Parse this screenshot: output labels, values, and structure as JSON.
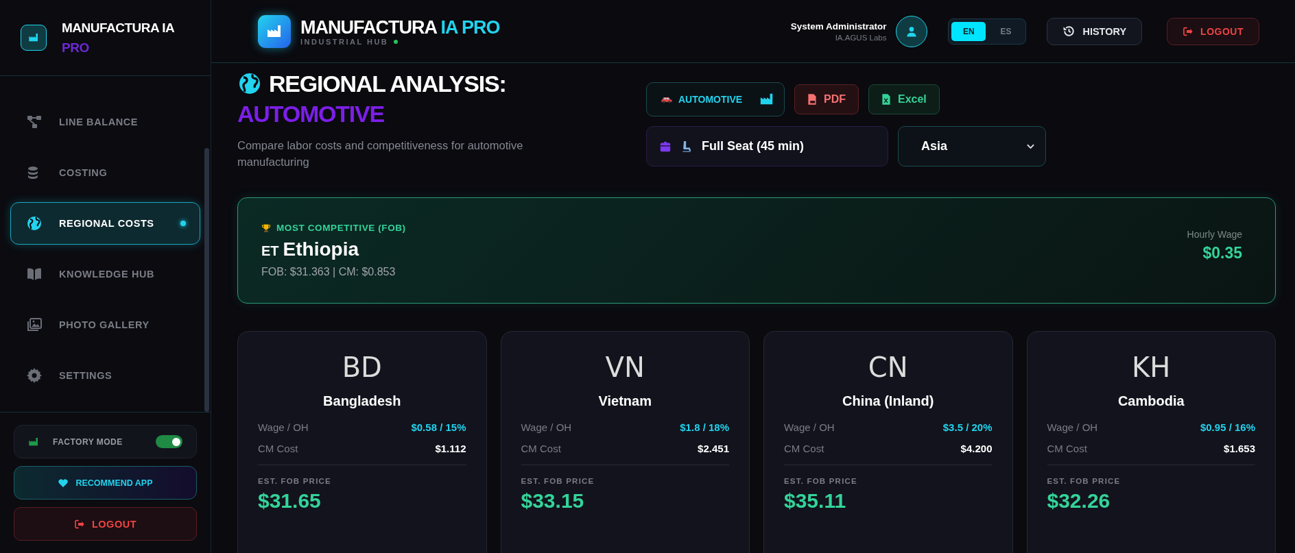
{
  "sidebar": {
    "brand": {
      "name": "MANUFACTURA IA",
      "tag": "PRO"
    },
    "items": [
      {
        "label": "LINE BALANCE",
        "selected": false
      },
      {
        "label": "COSTING",
        "selected": false
      },
      {
        "label": "REGIONAL COSTS",
        "selected": true
      },
      {
        "label": "KNOWLEDGE HUB",
        "selected": false
      },
      {
        "label": "PHOTO GALLERY",
        "selected": false
      },
      {
        "label": "SETTINGS",
        "selected": false
      }
    ],
    "factory_mode": {
      "label": "FACTORY MODE",
      "on": true
    },
    "recommend": "RECOMMEND APP",
    "logout": "LOGOUT"
  },
  "header": {
    "brand": {
      "name": "MANUFACTURA",
      "accent": "IA PRO",
      "subtitle": "INDUSTRIAL HUB"
    },
    "user": {
      "name": "System Administrator",
      "org": "IA.AGUS Labs"
    },
    "languages": [
      {
        "label": "EN",
        "selected": true
      },
      {
        "label": "ES",
        "selected": false
      }
    ],
    "history": "HISTORY",
    "logout": "LOGOUT"
  },
  "page": {
    "title": "REGIONAL ANALYSIS:",
    "title_accent": "AUTOMOTIVE",
    "description": "Compare labor costs and competitiveness for automotive manufacturing",
    "industry": "AUTOMOTIVE",
    "exports": [
      {
        "label": "PDF",
        "kind": "pdf"
      },
      {
        "label": "Excel",
        "kind": "excel"
      }
    ],
    "product": "Full Seat (45 min)",
    "region": "Asia"
  },
  "best": {
    "label": "MOST COMPETITIVE (FOB)",
    "code": "ET",
    "country": "Ethiopia",
    "detail": "FOB: $31.363 | CM: $0.853",
    "wage_label": "Hourly Wage",
    "wage": "$0.35"
  },
  "countries": [
    {
      "code": "BD",
      "name": "Bangladesh",
      "wage_label": "Wage / OH",
      "wage": "$0.58 / 15%",
      "cm_label": "CM Cost",
      "cm": "$1.112",
      "fob_label": "EST. FOB PRICE",
      "fob": "$31.65"
    },
    {
      "code": "VN",
      "name": "Vietnam",
      "wage_label": "Wage / OH",
      "wage": "$1.8 / 18%",
      "cm_label": "CM Cost",
      "cm": "$2.451",
      "fob_label": "EST. FOB PRICE",
      "fob": "$33.15"
    },
    {
      "code": "CN",
      "name": "China (Inland)",
      "wage_label": "Wage / OH",
      "wage": "$3.5 / 20%",
      "cm_label": "CM Cost",
      "cm": "$4.200",
      "fob_label": "EST. FOB PRICE",
      "fob": "$35.11"
    },
    {
      "code": "KH",
      "name": "Cambodia",
      "wage_label": "Wage / OH",
      "wage": "$0.95 / 16%",
      "cm_label": "CM Cost",
      "cm": "$1.653",
      "fob_label": "EST. FOB PRICE",
      "fob": "$32.26"
    }
  ]
}
